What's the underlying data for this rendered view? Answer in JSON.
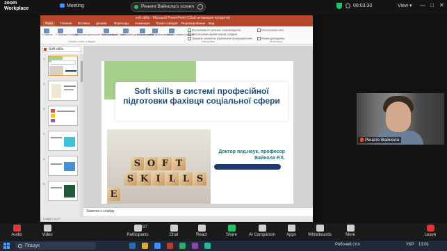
{
  "zoom": {
    "logo_line1": "zoom",
    "logo_line2": "Workplace",
    "meeting_label": "Meeting",
    "share_label": "Ренате Вайнола's screen",
    "timer": "00:03:30",
    "view_label": "View",
    "toolbar": [
      {
        "name": "audio",
        "label": "Audio"
      },
      {
        "name": "video",
        "label": "Video"
      },
      {
        "name": "participants",
        "label": "Participants",
        "count": "237"
      },
      {
        "name": "chat",
        "label": "Chat"
      },
      {
        "name": "react",
        "label": "React"
      },
      {
        "name": "share",
        "label": "Share"
      },
      {
        "name": "ai-companion",
        "label": "AI Companion"
      },
      {
        "name": "apps",
        "label": "Apps"
      },
      {
        "name": "whiteboards",
        "label": "Whiteboards"
      },
      {
        "name": "more",
        "label": "More"
      },
      {
        "name": "leave",
        "label": "Leave"
      }
    ],
    "participant_video": {
      "name": "Ренате Вайнола"
    }
  },
  "powerpoint": {
    "window_title": "soft skills - Microsoft PowerPoint (Сбой активации продукта)",
    "tabs": [
      "Файл",
      "Главная",
      "Вставка",
      "Дизайн",
      "Переходы",
      "Анимация",
      "Показ слайдов",
      "Рецензирование",
      "Вид"
    ],
    "ribbon_buttons": [
      "С начала",
      "С текущего слайда",
      "Широковещательный показ слайдов",
      "Произвольный показ",
      "Настройка демонстрации",
      "Скрыть слайд",
      "Настройка времени",
      "Запись показа слайдов"
    ],
    "ribbon_groups": [
      "Начать показ слайдов",
      "Настройка",
      "Мониторы"
    ],
    "checkboxes": [
      "Воспроизвести речевое сопровождение",
      "Использовать время показа слайдов",
      "Показать элементы управления проигрывателем"
    ],
    "monitor_option": "Использовать мон",
    "presenter_view": "Режим докладчика",
    "panel_tab": "Soft skills",
    "slide_numbers": [
      "1",
      "2",
      "3",
      "4",
      "5",
      "6"
    ],
    "slide": {
      "title": "Soft skills в системі професійної підготовки фахівця соціальної сфери",
      "author": "Доктор пед.наук, професор Вайнола Р.Х.",
      "image_letters": [
        "S",
        "O",
        "F",
        "T",
        "S",
        "K",
        "I",
        "L",
        "L",
        "S",
        "E"
      ]
    },
    "notes_placeholder": "Заметки к слайду",
    "status_text": "Слайд 1 из 27"
  },
  "taskbar": {
    "search_placeholder": "Пошук",
    "tray_label": "Робочий стіл",
    "language": "УКР",
    "time": "13:01"
  }
}
